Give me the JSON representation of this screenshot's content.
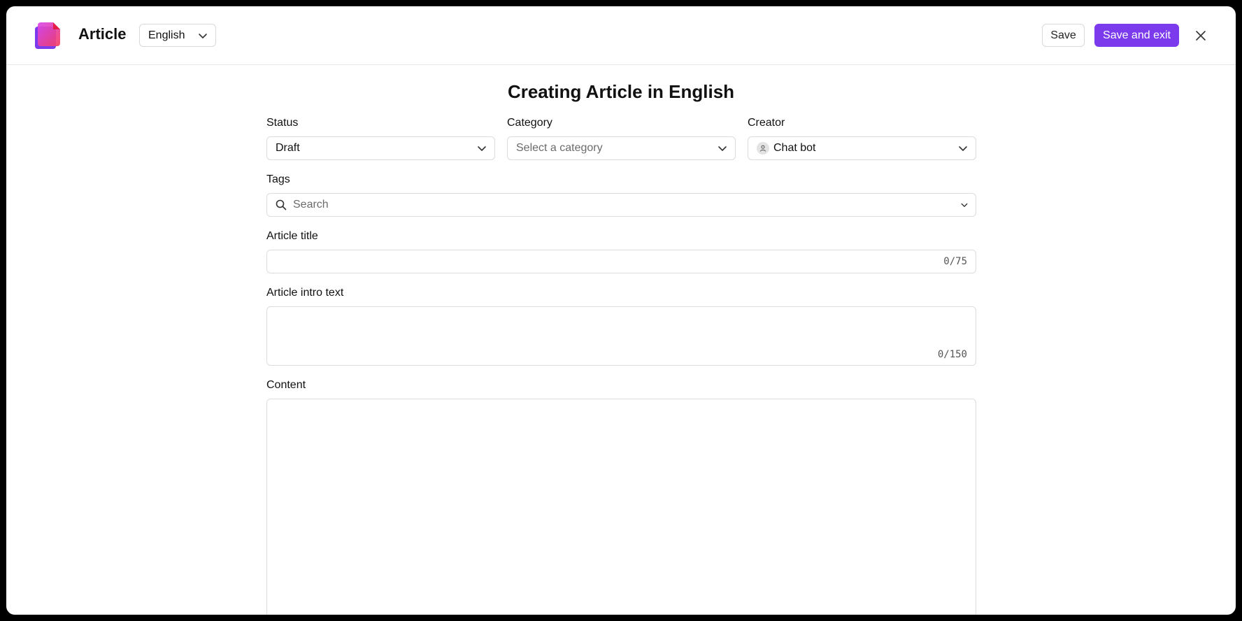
{
  "header": {
    "app_title": "Article",
    "language": "English",
    "save_label": "Save",
    "save_exit_label": "Save and exit",
    "accent_color": "#7c3aed"
  },
  "main": {
    "heading": "Creating Article in English",
    "status": {
      "label": "Status",
      "value": "Draft"
    },
    "category": {
      "label": "Category",
      "placeholder": "Select a category"
    },
    "creator": {
      "label": "Creator",
      "value": "Chat bot"
    },
    "tags": {
      "label": "Tags",
      "placeholder": "Search"
    },
    "article_title": {
      "label": "Article title",
      "value": "",
      "counter": "0/75"
    },
    "intro_text": {
      "label": "Article intro text",
      "value": "",
      "counter": "0/150"
    },
    "content": {
      "label": "Content",
      "value": ""
    }
  },
  "icons": [
    "article-logo-icon",
    "chevron-down-icon",
    "close-icon",
    "user-icon",
    "search-icon"
  ]
}
